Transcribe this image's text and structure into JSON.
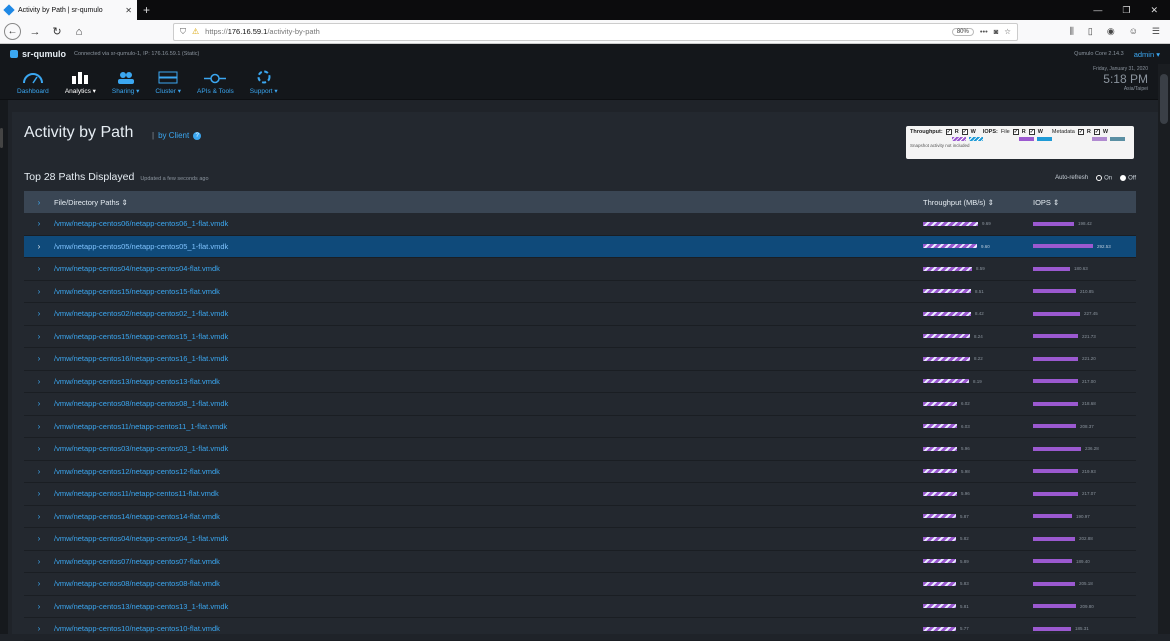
{
  "browser": {
    "tab_title": "Activity by Path | sr-qumulo",
    "url_prefix": "https://",
    "url_host": "176.16.59.1",
    "url_path": "/activity-by-path",
    "zoom": "80%"
  },
  "app": {
    "cluster_name": "sr-qumulo",
    "connection": "Connected via sr-qumulo-1, IP: 176.16.59.1 (Static)",
    "version": "Qumulo Core 2.14.3",
    "user": "admin",
    "date": "Friday, January 31, 2020",
    "time": "5:18 PM",
    "timezone": "Asia/Taipei"
  },
  "nav": [
    {
      "label": "Dashboard",
      "icon": "gauge-icon"
    },
    {
      "label": "Analytics ▾",
      "icon": "bar-chart-icon"
    },
    {
      "label": "Sharing ▾",
      "icon": "people-icon"
    },
    {
      "label": "Cluster ▾",
      "icon": "server-icon"
    },
    {
      "label": "APIs & Tools",
      "icon": "api-icon"
    },
    {
      "label": "Support ▾",
      "icon": "lifebuoy-icon"
    }
  ],
  "page": {
    "title": "Activity by Path",
    "separator": "|",
    "by_client": "by Client",
    "subtitle": "Top 28 Paths Displayed",
    "updated": "Updated a few seconds ago",
    "auto_refresh": "Auto-refresh",
    "on": "On",
    "off": "Off"
  },
  "legend": {
    "throughput": "Throughput:",
    "iops": "IOPS:",
    "file": "File",
    "metadata": "Metadata",
    "r": "R",
    "w": "W",
    "note": "Snapshot activity not included",
    "colors": {
      "read": "#9b59d0",
      "write": "#1e9ad6",
      "meta_read": "#9b59d0",
      "meta_write": "#5a8fa3"
    }
  },
  "table": {
    "headers": {
      "path": "File/Directory Paths ⇕",
      "throughput": "Throughput (MB/s) ⇕",
      "iops": "IOPS ⇕"
    },
    "max_throughput": 9.69,
    "max_iops": 292.53,
    "rows": [
      {
        "path": "/vmw/netapp-centos06/netapp-centos06_1-flat.vmdk",
        "throughput": "9.69",
        "iops": "198.42"
      },
      {
        "path": "/vmw/netapp-centos05/netapp-centos05_1-flat.vmdk",
        "throughput": "9.60",
        "iops": "292.53"
      },
      {
        "path": "/vmw/netapp-centos04/netapp-centos04-flat.vmdk",
        "throughput": "8.59",
        "iops": "180.63"
      },
      {
        "path": "/vmw/netapp-centos15/netapp-centos15-flat.vmdk",
        "throughput": "8.51",
        "iops": "210.85"
      },
      {
        "path": "/vmw/netapp-centos02/netapp-centos02_1-flat.vmdk",
        "throughput": "8.42",
        "iops": "227.45"
      },
      {
        "path": "/vmw/netapp-centos15/netapp-centos15_1-flat.vmdk",
        "throughput": "8.24",
        "iops": "221.73"
      },
      {
        "path": "/vmw/netapp-centos16/netapp-centos16_1-flat.vmdk",
        "throughput": "8.22",
        "iops": "221.20"
      },
      {
        "path": "/vmw/netapp-centos13/netapp-centos13-flat.vmdk",
        "throughput": "8.19",
        "iops": "217.00"
      },
      {
        "path": "/vmw/netapp-centos08/netapp-centos08_1-flat.vmdk",
        "throughput": "6.02",
        "iops": "218.68"
      },
      {
        "path": "/vmw/netapp-centos11/netapp-centos11_1-flat.vmdk",
        "throughput": "6.03",
        "iops": "208.37"
      },
      {
        "path": "/vmw/netapp-centos03/netapp-centos03_1-flat.vmdk",
        "throughput": "5.96",
        "iops": "236.28"
      },
      {
        "path": "/vmw/netapp-centos12/netapp-centos12-flat.vmdk",
        "throughput": "5.98",
        "iops": "219.93"
      },
      {
        "path": "/vmw/netapp-centos11/netapp-centos11-flat.vmdk",
        "throughput": "5.96",
        "iops": "217.07"
      },
      {
        "path": "/vmw/netapp-centos14/netapp-centos14-flat.vmdk",
        "throughput": "5.87",
        "iops": "190.97"
      },
      {
        "path": "/vmw/netapp-centos04/netapp-centos04_1-flat.vmdk",
        "throughput": "5.82",
        "iops": "202.88"
      },
      {
        "path": "/vmw/netapp-centos07/netapp-centos07-flat.vmdk",
        "throughput": "5.89",
        "iops": "189.40"
      },
      {
        "path": "/vmw/netapp-centos08/netapp-centos08-flat.vmdk",
        "throughput": "5.83",
        "iops": "205.18"
      },
      {
        "path": "/vmw/netapp-centos13/netapp-centos13_1-flat.vmdk",
        "throughput": "5.81",
        "iops": "209.80"
      },
      {
        "path": "/vmw/netapp-centos10/netapp-centos10-flat.vmdk",
        "throughput": "5.77",
        "iops": "185.31"
      }
    ]
  }
}
